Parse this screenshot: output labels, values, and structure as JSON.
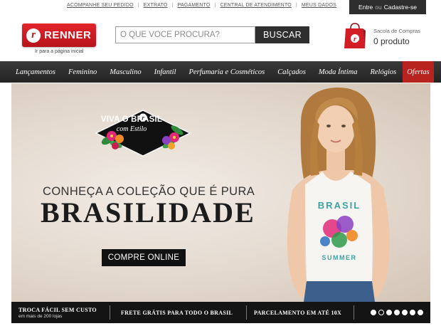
{
  "top_links": [
    "ACOMPANHE SEU PEDIDO",
    "EXTRATO",
    "PAGAMENTO",
    "CENTRAL DE ATENDIMENTO",
    "MEUS DADOS"
  ],
  "login": {
    "enter": "Entre",
    "or": "ou",
    "register": "Cadastre-se"
  },
  "logo": {
    "mark": "r",
    "name": "RENNER",
    "sub": "Ir para a página inicial"
  },
  "search": {
    "placeholder": "O QUE VOCÊ PROCURA?",
    "button": "BUSCAR"
  },
  "cart": {
    "label": "Sacola de Compras",
    "count": "0 produto",
    "icon": "shopping-bag-icon"
  },
  "nav": {
    "items": [
      "Lançamentos",
      "Feminino",
      "Masculino",
      "Infantil",
      "Perfumaria e Cosméticos",
      "Calçados",
      "Moda Íntima",
      "Relógios"
    ],
    "highlight": "Ofertas"
  },
  "hero": {
    "badge_mark": "r",
    "badge_title": "VIVA O BRASIL",
    "badge_sub": "com Estilo",
    "line": "CONHEÇA A COLEÇÃO QUE É PURA",
    "title": "BRASILIDADE",
    "cta": "COMPRE ONLINE",
    "shirt_text_top": "BRASIL",
    "shirt_text_bottom": "SUMMER"
  },
  "info_bar": {
    "items": [
      {
        "title": "TROCA FÁCIL SEM CUSTO",
        "sub": "em mais de 200 lojas"
      },
      {
        "title": "FRETE GRÁTIS PARA TODO O BRASIL",
        "sub": ""
      },
      {
        "title": "PARCELAMENTO EM ATÉ 10X",
        "sub": ""
      }
    ],
    "slides_total": 7,
    "slides_active": 2
  },
  "colors": {
    "brand_red": "#c8161d",
    "nav_bg": "#2b2b2b",
    "offer_red": "#b8231f"
  }
}
